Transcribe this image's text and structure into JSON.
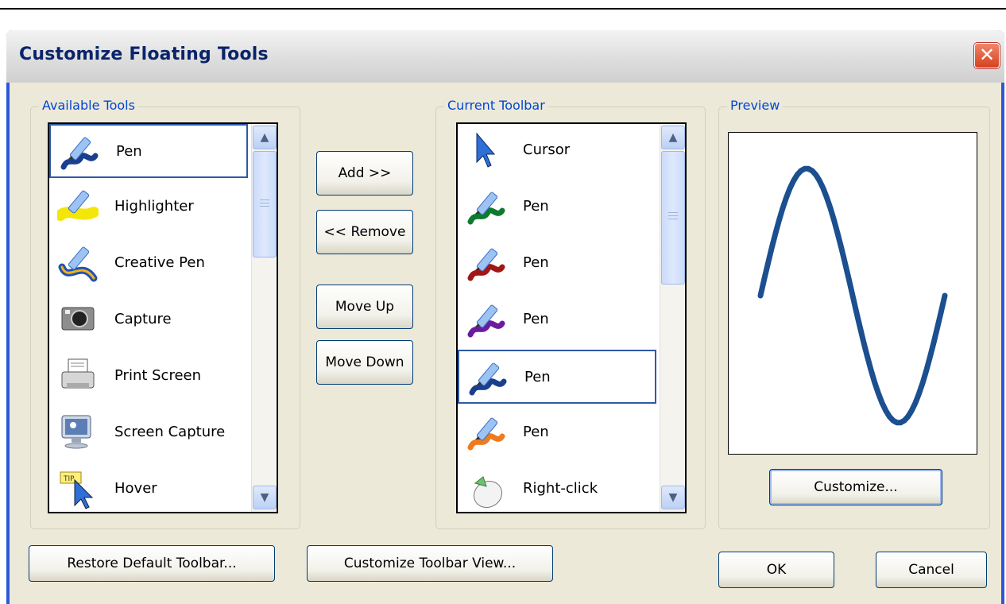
{
  "dialog": {
    "title": "Customize Floating Tools",
    "close_glyph": "✕"
  },
  "available": {
    "label": "Available Tools",
    "items": [
      {
        "label": "Pen",
        "icon": "pen-icon",
        "color": "#1b3f8f"
      },
      {
        "label": "Highlighter",
        "icon": "highlighter-icon",
        "color": "#f5e60a"
      },
      {
        "label": "Creative Pen",
        "icon": "creative-pen-icon",
        "color": "#2352b0"
      },
      {
        "label": "Capture",
        "icon": "camera-icon"
      },
      {
        "label": "Print Screen",
        "icon": "printer-icon"
      },
      {
        "label": "Screen Capture",
        "icon": "monitor-icon"
      },
      {
        "label": "Hover",
        "icon": "tip-cursor-icon"
      }
    ]
  },
  "middle_buttons": {
    "add": "Add >>",
    "remove": "<< Remove",
    "move_up": "Move Up",
    "move_down": "Move Down"
  },
  "current": {
    "label": "Current Toolbar",
    "items": [
      {
        "label": "Cursor",
        "icon": "cursor-arrow-icon",
        "color": "#2e6fd8"
      },
      {
        "label": "Pen",
        "icon": "pen-icon",
        "color": "#0e7a2e"
      },
      {
        "label": "Pen",
        "icon": "pen-icon",
        "color": "#a31616"
      },
      {
        "label": "Pen",
        "icon": "pen-icon",
        "color": "#6b1c9c"
      },
      {
        "label": "Pen",
        "icon": "pen-icon",
        "color": "#1b3f8f"
      },
      {
        "label": "Pen",
        "icon": "pen-icon",
        "color": "#f07a1e"
      },
      {
        "label": "Right-click",
        "icon": "mouse-icon"
      }
    ]
  },
  "preview": {
    "label": "Preview",
    "stroke_color": "#1b4f8f",
    "customize": "Customize..."
  },
  "bottom": {
    "restore": "Restore Default Toolbar...",
    "customize_view": "Customize Toolbar View...",
    "ok": "OK",
    "cancel": "Cancel"
  },
  "scrollbar_glyphs": {
    "up": "▲",
    "down": "▼"
  }
}
